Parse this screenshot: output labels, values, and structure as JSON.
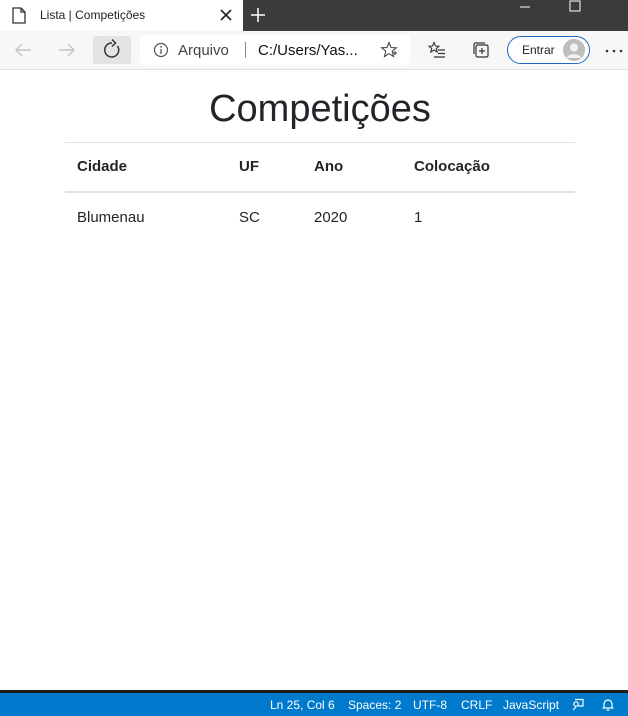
{
  "browser": {
    "tab_title": "Lista | Competições",
    "site_label": "Arquivo",
    "url": "C:/Users/Yas...",
    "signin_label": "Entrar"
  },
  "page": {
    "title": "Competições",
    "table": {
      "headers": [
        "Cidade",
        "UF",
        "Ano",
        "Colocação"
      ],
      "rows": [
        [
          "Blumenau",
          "SC",
          "2020",
          "1"
        ]
      ]
    }
  },
  "statusbar": {
    "position": "Ln 25, Col 6",
    "spaces": "Spaces: 2",
    "encoding": "UTF-8",
    "eol": "CRLF",
    "language": "JavaScript"
  },
  "colors": {
    "statusbar": "#007acc",
    "titlebar": "#3b3b3b",
    "signin_border": "#1f6bbd"
  },
  "icons": [
    "page-icon",
    "close-icon",
    "plus-icon",
    "minimize-icon",
    "maximize-icon",
    "back-icon",
    "forward-icon",
    "refresh-icon",
    "info-icon",
    "star-icon",
    "favorites-icon",
    "collections-icon",
    "avatar",
    "more-icon",
    "feedback-icon",
    "bell-icon"
  ]
}
